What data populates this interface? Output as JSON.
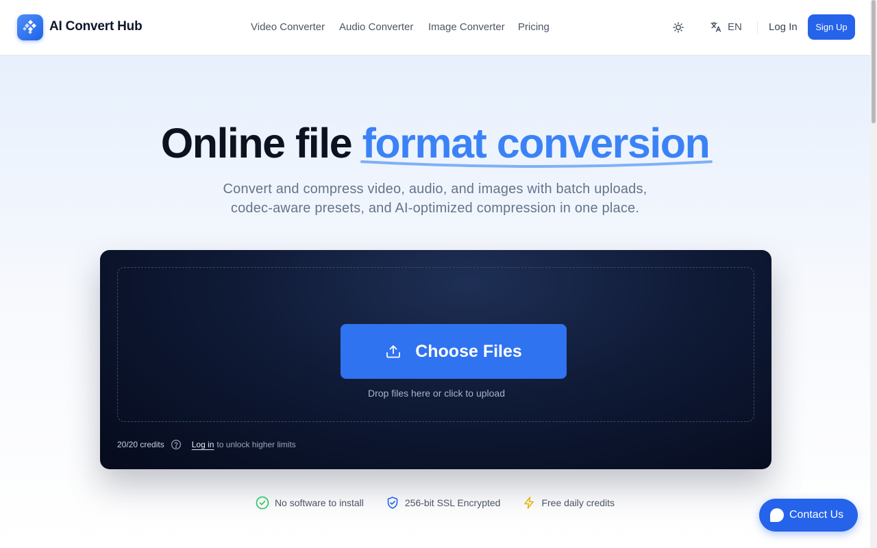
{
  "brand": {
    "name": "AI Convert Hub",
    "logo_icon": "diamond-grid-logo"
  },
  "nav": {
    "items": [
      {
        "label": "Video Converter"
      },
      {
        "label": "Audio Converter"
      },
      {
        "label": "Image Converter"
      },
      {
        "label": "Pricing"
      }
    ]
  },
  "header_actions": {
    "theme_icon": "sun-icon",
    "language_icon": "translate-icon",
    "language": "EN",
    "login_label": "Log In",
    "signup_label": "Sign Up"
  },
  "hero": {
    "title_plain": "Online file ",
    "title_accent": "format conversion",
    "subtitle_line1": "Convert and compress video, audio, and images with batch uploads,",
    "subtitle_line2": "codec-aware presets, and AI-optimized compression in one place."
  },
  "upload": {
    "button_label": "Choose Files",
    "button_icon": "upload-icon",
    "hint": "Drop files here or click to upload",
    "credits": "20/20 credits",
    "help_icon": "question-circle-icon",
    "login_link": "Log in",
    "login_suffix": "to unlock higher limits"
  },
  "features": [
    {
      "label": "No software to install",
      "icon": "check-circle-icon",
      "color": "#22c55e"
    },
    {
      "label": "256-bit SSL Encrypted",
      "icon": "shield-check-icon",
      "color": "#2563eb"
    },
    {
      "label": "Free daily credits",
      "icon": "lightning-icon",
      "color": "#eab308"
    }
  ],
  "contact": {
    "label": "Contact Us",
    "icon": "chat-bubble-icon"
  },
  "colors": {
    "accent": "#2563eb",
    "title_accent": "#3b82f6",
    "card_bg": "#0f1a36"
  }
}
